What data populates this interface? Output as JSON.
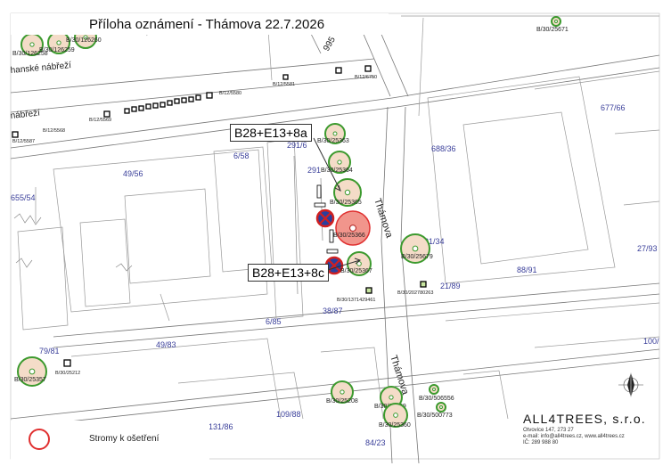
{
  "title": "Příloha oznámení - Thámova 22.7.2026",
  "callouts": [
    {
      "id": "a",
      "text": "B28+E13+8a"
    },
    {
      "id": "c",
      "text": "B28+E13+8c"
    }
  ],
  "legend": {
    "label": "Stromy k ošetření",
    "color": "#e03030"
  },
  "company": {
    "name": "ALL4TREES, s.r.o.",
    "address": "Otvovice 147, 273 27",
    "contact": "e-mail: info@all4trees.cz, www.all4trees.cz",
    "ic": "IČ: 289 988 80"
  },
  "streets": [
    {
      "id": "nabrezi1",
      "text": "hanské nábřeží"
    },
    {
      "id": "nabrezi2",
      "text": "nábřeží"
    },
    {
      "id": "thamova1",
      "text": "Thámova"
    },
    {
      "id": "thamova2",
      "text": "Thámova"
    },
    {
      "id": "s995",
      "text": "995"
    }
  ],
  "parcels": [
    {
      "id": "p1",
      "text": "677/66"
    },
    {
      "id": "p2",
      "text": "688/36"
    },
    {
      "id": "p3",
      "text": "49/56"
    },
    {
      "id": "p4",
      "text": "6/58"
    },
    {
      "id": "p5",
      "text": "291/6"
    },
    {
      "id": "p6",
      "text": "291"
    },
    {
      "id": "p7",
      "text": "655/54"
    },
    {
      "id": "p8",
      "text": "21/34"
    },
    {
      "id": "p9",
      "text": "27/93"
    },
    {
      "id": "p10",
      "text": "88/91"
    },
    {
      "id": "p11",
      "text": "21/89"
    },
    {
      "id": "p12",
      "text": "38/87"
    },
    {
      "id": "p13",
      "text": "6/85"
    },
    {
      "id": "p14",
      "text": "49/83"
    },
    {
      "id": "p15",
      "text": "79/81"
    },
    {
      "id": "p16",
      "text": "109/88"
    },
    {
      "id": "p17",
      "text": "131/86"
    },
    {
      "id": "p18",
      "text": "84/23"
    },
    {
      "id": "p19",
      "text": "100/"
    }
  ],
  "trees": [
    {
      "id": "t1",
      "label": "B/30/25363",
      "treat": false
    },
    {
      "id": "t2",
      "label": "B/30/25364",
      "treat": false
    },
    {
      "id": "t3",
      "label": "B/30/25365",
      "treat": false
    },
    {
      "id": "t4",
      "label": "B/30/25366",
      "treat": true
    },
    {
      "id": "t5",
      "label": "B/30/25367",
      "treat": false
    },
    {
      "id": "t6",
      "label": "B/30/25679",
      "treat": false
    },
    {
      "id": "t7",
      "label": "B/30/25357",
      "treat": false
    },
    {
      "id": "t8",
      "label": "B/30/25208",
      "treat": false
    },
    {
      "id": "t9",
      "label": "B/30/25359",
      "treat": false
    },
    {
      "id": "t10",
      "label": "B/30/25360",
      "treat": false
    },
    {
      "id": "t11",
      "label": "B/30/500773",
      "treat": false
    },
    {
      "id": "t12",
      "label": "B/30/506556",
      "treat": false
    },
    {
      "id": "t13",
      "label": "B/30/25671",
      "treat": false
    },
    {
      "id": "t14",
      "label": "B/30/126258",
      "treat": false
    },
    {
      "id": "t15",
      "label": "B/30/126259",
      "treat": false
    },
    {
      "id": "t16",
      "label": "B/30/126260",
      "treat": false
    }
  ],
  "small_labels": [
    {
      "id": "s1",
      "text": "B/30/1371429461"
    },
    {
      "id": "s2",
      "text": "B/30/202780263"
    },
    {
      "id": "s3",
      "text": "B/12/6750"
    },
    {
      "id": "s4",
      "text": "B/12/5580"
    },
    {
      "id": "s5",
      "text": "B/12/5581"
    },
    {
      "id": "s6",
      "text": "B/12/5568"
    },
    {
      "id": "s7",
      "text": "B/12/5569"
    },
    {
      "id": "s8",
      "text": "B/12/5587"
    },
    {
      "id": "s9",
      "text": "B/30/25212"
    }
  ],
  "colors": {
    "tree_green": "#3c9a2e",
    "tree_fill": "#f4dcc8",
    "treat_fill": "#f08a80",
    "parcel_blue": "#3a3f9a",
    "line": "#8a8a8a",
    "road_line": "#777777"
  }
}
